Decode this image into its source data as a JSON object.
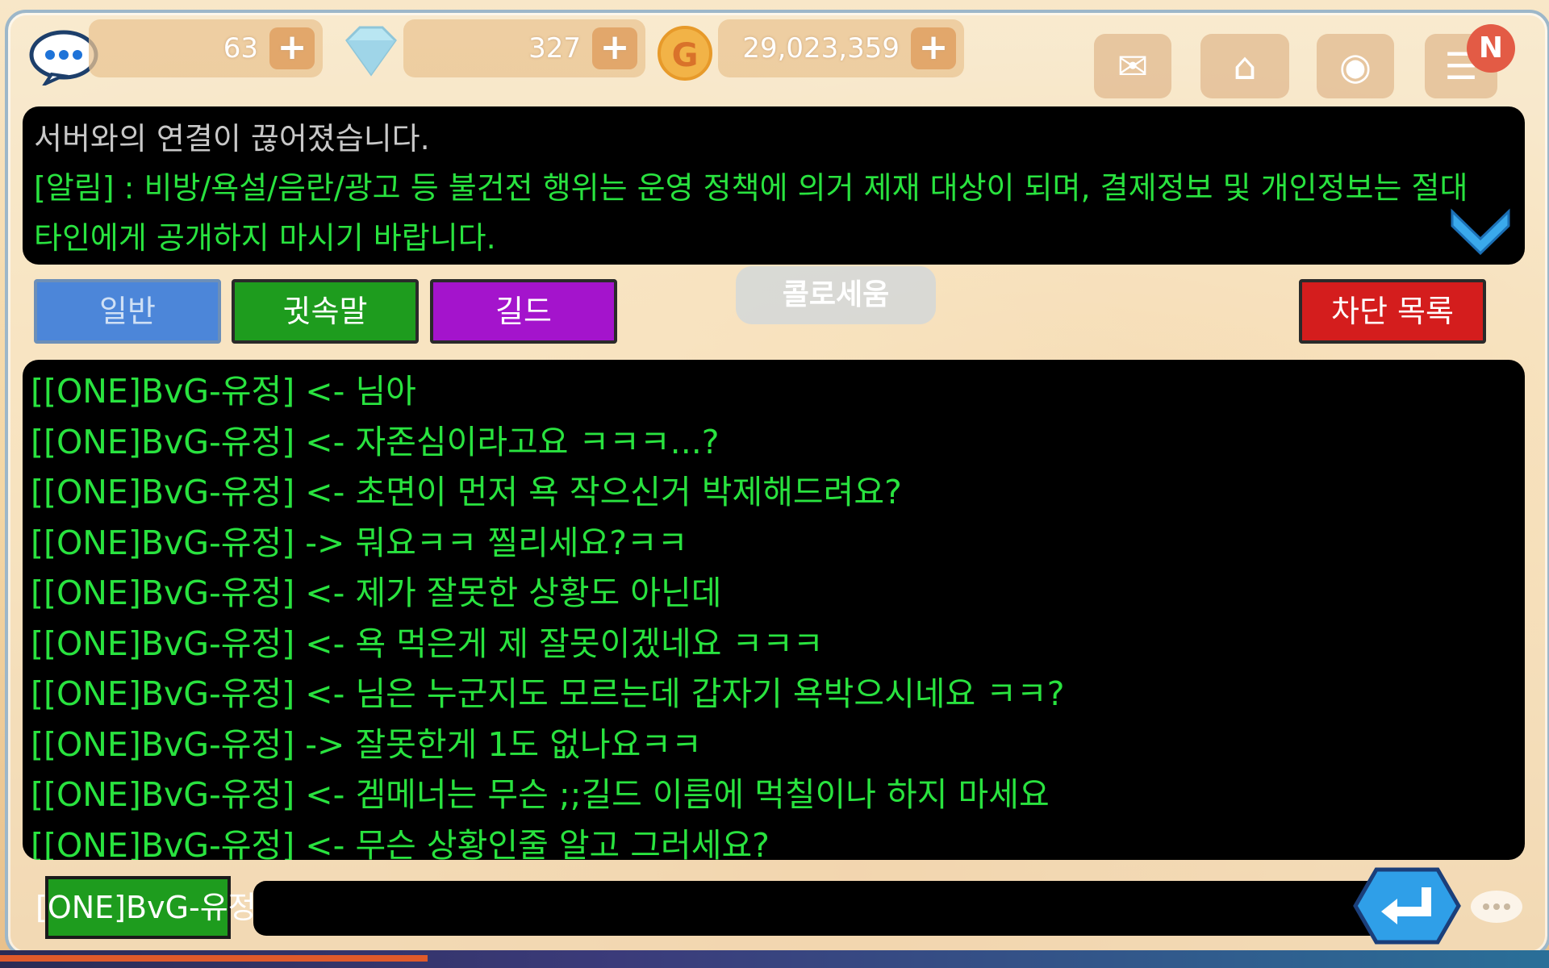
{
  "resources": {
    "stamina": "63",
    "gems": "327",
    "gold": "29,023,359",
    "plus_label": "+",
    "coin_glyph": "G"
  },
  "top_icons": {
    "notification_badge": "N"
  },
  "notice": {
    "system_message": "서버와의 연결이 끊어졌습니다.",
    "alert_message": "[알림] : 비방/욕설/음란/광고 등 불건전 행위는 운영 정책에 의거 제재 대상이 되며, 결제정보 및 개인정보는 절대 타인에게 공개하지 마시기 바랍니다."
  },
  "tabs": {
    "general": "일반",
    "whisper": "귓속말",
    "guild": "길드",
    "block_list": "차단 목록",
    "colosseum": "콜로세움"
  },
  "chat_log": [
    "[[ONE]BvG-유정] <- 님아",
    "[[ONE]BvG-유정] <- 자존심이라고요 ㅋㅋㅋ...?",
    "[[ONE]BvG-유정] <- 초면이 먼저 욕 작으신거 박제해드려요?",
    "[[ONE]BvG-유정] -> 뭐요ㅋㅋ 찔리세요?ㅋㅋ",
    "[[ONE]BvG-유정] <- 제가 잘못한 상황도 아닌데",
    "[[ONE]BvG-유정] <- 욕 먹은게 제 잘못이겠네요 ㅋㅋㅋ",
    "[[ONE]BvG-유정] <- 님은 누군지도 모르는데 갑자기 욕박으시네요 ㅋㅋ?",
    "[[ONE]BvG-유정] -> 잘못한게 1도 없나요ㅋㅋ",
    "[[ONE]BvG-유정] <- 겜메너는 무슨 ;;길드 이름에 먹칠이나 하지 마세요",
    "[[ONE]BvG-유정] <- 무슨 상황인줄 알고 그러세요?"
  ],
  "input": {
    "sender": "[ONE]BvG-유정",
    "value": ""
  },
  "colors": {
    "chat_text": "#29e33f",
    "tab_general": "#4c86d9",
    "tab_whisper": "#1e9c1e",
    "tab_guild": "#a414cc",
    "tab_block": "#d41d1d"
  },
  "icons": [
    "chat-bubble-icon",
    "gem-icon",
    "coin-icon",
    "mail-icon",
    "guild-house-icon",
    "map-pin-icon",
    "quest-list-icon",
    "chevron-down-icon",
    "enter-arrow-icon"
  ]
}
